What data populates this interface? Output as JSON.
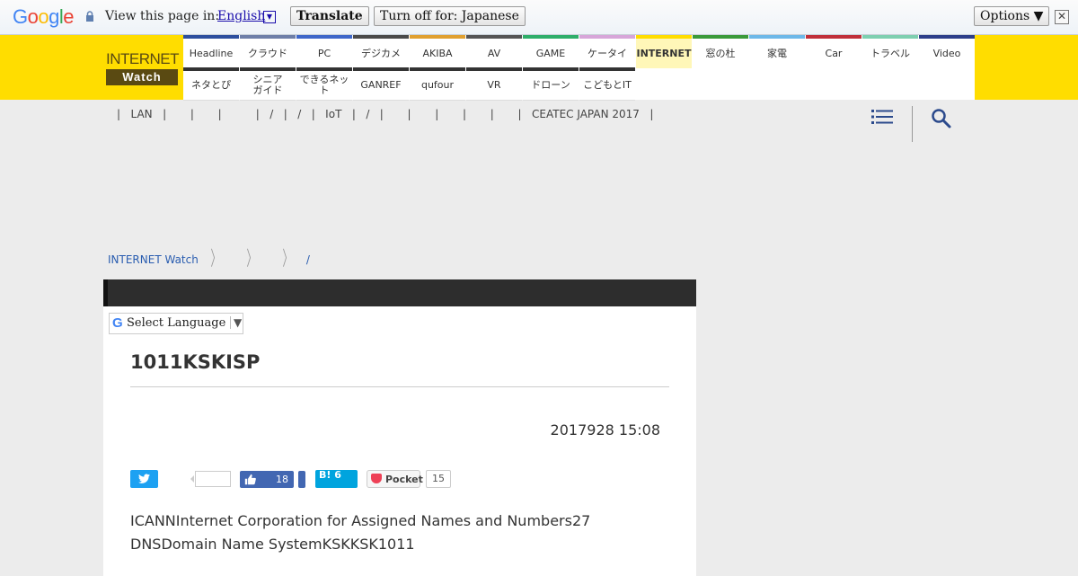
{
  "translate_bar": {
    "logo_letters": [
      "G",
      "o",
      "o",
      "g",
      "l",
      "e"
    ],
    "view_label": "View this page in:",
    "language": "English",
    "translate_button": "Translate",
    "turn_off_button": "Turn off for: Japanese",
    "options_button": "Options ▼",
    "close_glyph": "✕"
  },
  "site": {
    "logo_top": "INTERNET",
    "logo_bottom": "Watch",
    "nav_row1": [
      {
        "label": "Headline",
        "color": "#2d4f9e"
      },
      {
        "label": "クラウド",
        "color": "#6e7fa8"
      },
      {
        "label": "PC",
        "color": "#3e67c9"
      },
      {
        "label": "デジカメ",
        "color": "#4a4a4a"
      },
      {
        "label": "AKIBA",
        "color": "#e0a030"
      },
      {
        "label": "AV",
        "color": "#555555"
      },
      {
        "label": "GAME",
        "color": "#2eae6a"
      },
      {
        "label": "ケータイ",
        "color": "#d7a6d9"
      },
      {
        "label": "INTERNET",
        "color": "#ffdd00"
      },
      {
        "label": "窓の杜",
        "color": "#3a9a3a"
      },
      {
        "label": "家電",
        "color": "#6db8e8"
      },
      {
        "label": "Car",
        "color": "#c0303a"
      },
      {
        "label": "トラベル",
        "color": "#7ecfb0"
      },
      {
        "label": "Video",
        "color": "#2d3f8a"
      }
    ],
    "nav_row2": [
      "ネタとぴ",
      "シニア\nガイド",
      "できるネット",
      "GANREF",
      "qufour",
      "VR",
      "ドローン",
      "こどもとIT"
    ],
    "keywords": "|   LAN   |       |       |          |   /   |   /   |   IoT   |   /   |       |       |       |       |       |   CEATEC JAPAN 2017   |"
  },
  "breadcrumb": [
    "INTERNET Watch",
    "",
    "/"
  ],
  "article": {
    "select_language": "Select Language",
    "title": "1011KSKISP",
    "date": "2017928 15:08",
    "like_count": "18",
    "hatena_label": "B! 6",
    "pocket_label": "Pocket",
    "pocket_count": "15",
    "body_line1": "ICANNInternet Corporation for Assigned Names and Numbers27",
    "body_line2": "DNSDomain Name SystemKSKKSK1011"
  }
}
